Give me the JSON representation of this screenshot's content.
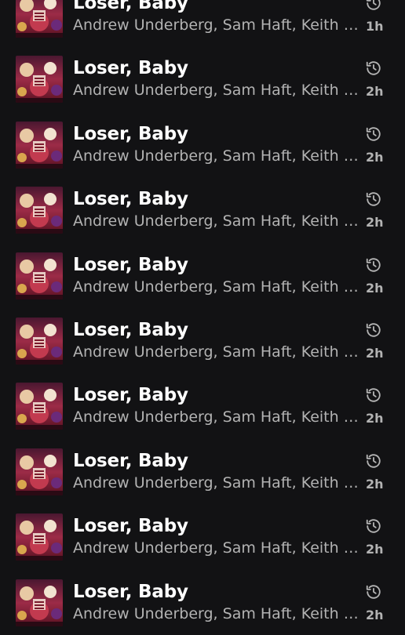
{
  "recent_items": [
    {
      "title": "Loser, Baby",
      "artists": "Andrew Underberg, Sam Haft, Keith David, Blake Roman, Alex Brightman",
      "age": "1h",
      "icon": "history-icon",
      "artwork": "album-art-hazbin-hotel"
    },
    {
      "title": "Loser, Baby",
      "artists": "Andrew Underberg, Sam Haft, Keith David, Blake Roman, Alex Brightman",
      "age": "2h",
      "icon": "history-icon",
      "artwork": "album-art-hazbin-hotel"
    },
    {
      "title": "Loser, Baby",
      "artists": "Andrew Underberg, Sam Haft, Keith David, Blake Roman, Alex Brightman",
      "age": "2h",
      "icon": "history-icon",
      "artwork": "album-art-hazbin-hotel"
    },
    {
      "title": "Loser, Baby",
      "artists": "Andrew Underberg, Sam Haft, Keith David, Blake Roman, Alex Brightman",
      "age": "2h",
      "icon": "history-icon",
      "artwork": "album-art-hazbin-hotel"
    },
    {
      "title": "Loser, Baby",
      "artists": "Andrew Underberg, Sam Haft, Keith David, Blake Roman, Alex Brightman",
      "age": "2h",
      "icon": "history-icon",
      "artwork": "album-art-hazbin-hotel"
    },
    {
      "title": "Loser, Baby",
      "artists": "Andrew Underberg, Sam Haft, Keith David, Blake Roman, Alex Brightman",
      "age": "2h",
      "icon": "history-icon",
      "artwork": "album-art-hazbin-hotel"
    },
    {
      "title": "Loser, Baby",
      "artists": "Andrew Underberg, Sam Haft, Keith David, Blake Roman, Alex Brightman",
      "age": "2h",
      "icon": "history-icon",
      "artwork": "album-art-hazbin-hotel"
    },
    {
      "title": "Loser, Baby",
      "artists": "Andrew Underberg, Sam Haft, Keith David, Blake Roman, Alex Brightman",
      "age": "2h",
      "icon": "history-icon",
      "artwork": "album-art-hazbin-hotel"
    },
    {
      "title": "Loser, Baby",
      "artists": "Andrew Underberg, Sam Haft, Keith David, Blake Roman, Alex Brightman",
      "age": "2h",
      "icon": "history-icon",
      "artwork": "album-art-hazbin-hotel"
    },
    {
      "title": "Loser, Baby",
      "artists": "Andrew Underberg, Sam Haft, Keith David, Blake Roman, Alex Brightman",
      "age": "2h",
      "icon": "history-icon",
      "artwork": "album-art-hazbin-hotel"
    }
  ],
  "colors": {
    "background": "#121214",
    "title": "#ffffff",
    "secondary_text": "#b3b3b3",
    "icon": "#b3b3b3"
  }
}
